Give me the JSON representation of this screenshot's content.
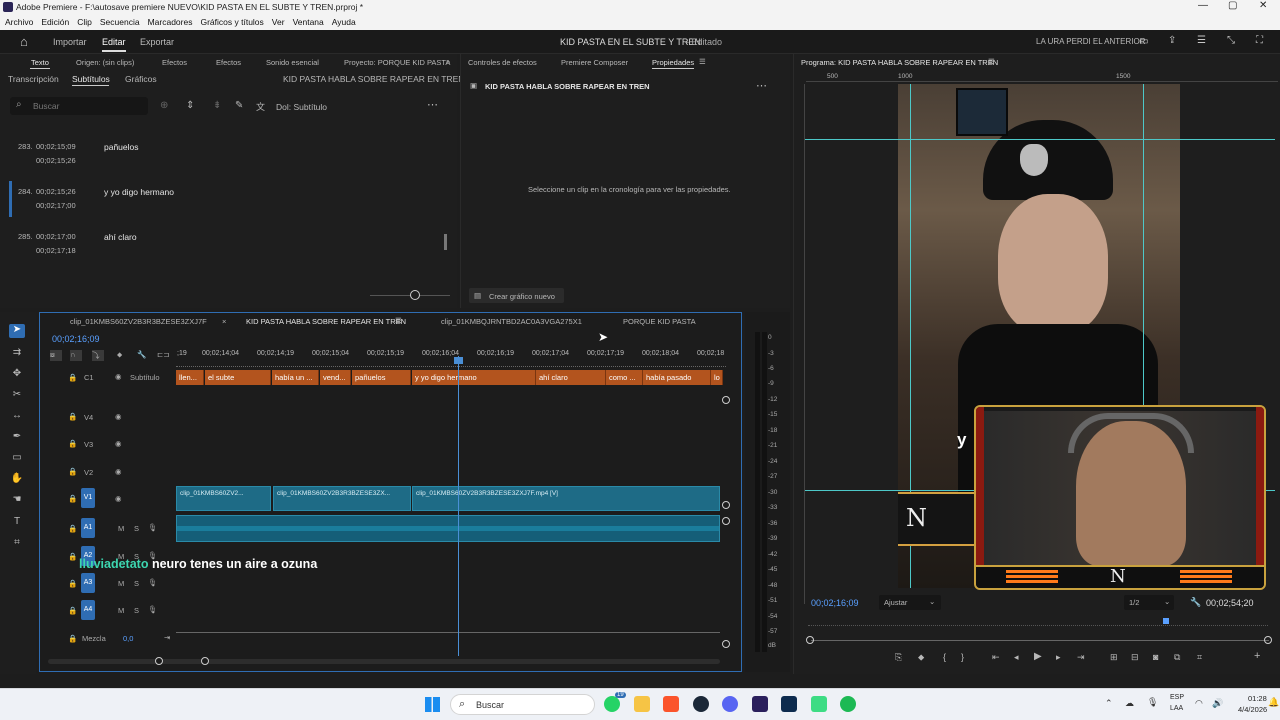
{
  "window": {
    "title": "Adobe Premiere - F:\\autosave premiere NUEVO\\KID PASTA EN EL SUBTE Y TREN.prproj *"
  },
  "menu": [
    "Archivo",
    "Edición",
    "Clip",
    "Secuencia",
    "Marcadores",
    "Gráficos y títulos",
    "Ver",
    "Ventana",
    "Ayuda"
  ],
  "header": {
    "importar": "Importar",
    "editar": "Editar",
    "exportar": "Exportar",
    "project_title": "KID PASTA EN EL SUBTE Y TREN",
    "edited": "- Editado",
    "right_label": "LA URA PERDI EL ANTERIOR"
  },
  "text_panel": {
    "tab_texto": "Texto",
    "tab_origen": "Origen: (sin clips)",
    "tab_efectos": "Efectos",
    "tab_sonido": "Sonido esencial",
    "tab_proyecto": "Proyecto: PORQUE KID PASTA",
    "sub_transcripcion": "Transcripción",
    "sub_subtitulos": "Subtítulos",
    "sub_graficos": "Gráficos",
    "sequence_name": "KID PASTA HABLA SOBRE RAPEAR EN TREN",
    "search_placeholder": "Buscar",
    "style_label": "Dol: Subtítulo",
    "entries": [
      {
        "num": "283.",
        "in": "00;02;15;09",
        "out": "00;02;15;26",
        "text": "pañuelos"
      },
      {
        "num": "284.",
        "in": "00;02;15;26",
        "out": "00;02;17;00",
        "text": "y yo digo hermano"
      },
      {
        "num": "285.",
        "in": "00;02;17;00",
        "out": "00;02;17;18",
        "text": "ahí claro"
      }
    ]
  },
  "props_panel": {
    "tab_controles": "Controles de efectos",
    "tab_composer": "Premiere Composer",
    "tab_propiedades": "Propiedades",
    "title": "KID PASTA HABLA SOBRE RAPEAR EN TREN",
    "message": "Seleccione un clip en la cronología para ver las propiedades.",
    "create_button": "Crear gráfico nuevo"
  },
  "program": {
    "tab": "Programa: KID PASTA HABLA SOBRE RAPEAR EN TREN",
    "timecode": "00;02;16;09",
    "fit": "Ajustar",
    "quality": "1/2",
    "duration": "00;02;54;20",
    "ruler": [
      "500",
      "1000",
      "1500"
    ],
    "overlay_letter": "y",
    "logo_letter": "N"
  },
  "timeline": {
    "tabs": [
      "clip_01KMBS60ZV2B3R3BZESE3ZXJ7F",
      "KID PASTA HABLA SOBRE RAPEAR EN TREN",
      "clip_01KMBQJRNTBD2AC0A3VGA275X1",
      "PORQUE KID PASTA"
    ],
    "timecode": "00;02;16;09",
    "ruler": [
      ";19",
      "00;02;14;04",
      "00;02;14;19",
      "00;02;15;04",
      "00;02;15;19",
      "00;02;16;04",
      "00;02;16;19",
      "00;02;17;04",
      "00;02;17;19",
      "00;02;18;04",
      "00;02;18"
    ],
    "caption_track": {
      "name": "C1",
      "label": "Subtítulo",
      "cells": [
        "llen...",
        "el subte",
        "había un ...",
        "vend...",
        "pañuelos",
        "y yo digo hermano",
        "ahí claro",
        "como ...",
        "había pasado",
        "lo"
      ]
    },
    "video_tracks": [
      "V4",
      "V3",
      "V2",
      "V1"
    ],
    "audio_tracks": [
      "A1",
      "A2",
      "A3",
      "A4"
    ],
    "video_clips": [
      "clip_01KMBS60ZV2...",
      "clip_01KMBS60ZV2B3R3BZESE3ZX...",
      "clip_01KMBS60ZV2B3R3BZESE3ZXJ7F.mp4 [V]"
    ],
    "mix_label": "Mezcla",
    "mix_value": "0,0",
    "subtitle_overlay_user": "lluviadetato",
    "subtitle_overlay_text": "neuro tenes un aire a ozuna"
  },
  "meter": {
    "labels": [
      "0",
      "-3",
      "-6",
      "-9",
      "-12",
      "-15",
      "-18",
      "-21",
      "-24",
      "-27",
      "-30",
      "-33",
      "-36",
      "-39",
      "-42",
      "-45",
      "-48",
      "-51",
      "-54",
      "-57",
      "dB"
    ]
  },
  "taskbar": {
    "search": "Buscar",
    "lang1": "ESP",
    "lang2": "LAA",
    "time": "01:28",
    "date": "4/4/2026",
    "badge": "19"
  },
  "colors": {
    "accent": "#2f6db3",
    "caption": "#b3541e",
    "video_clip": "#1e6b86",
    "audio_clip": "#1a6e88",
    "playhead": "#4a8fd6"
  }
}
